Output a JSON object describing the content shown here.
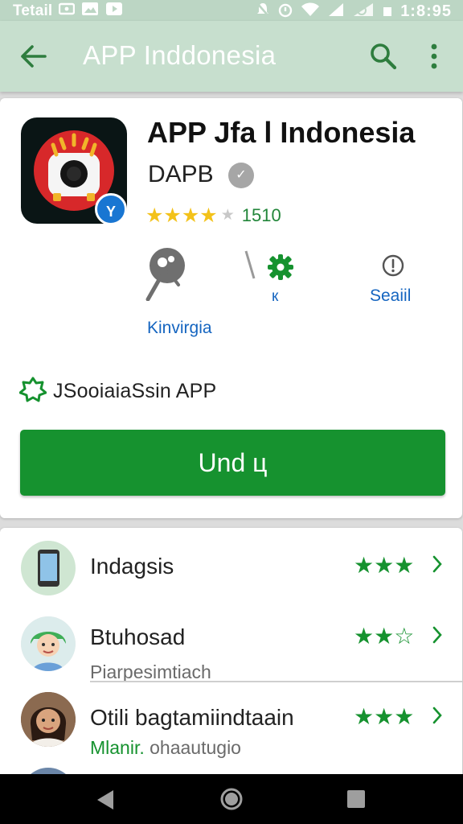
{
  "status_bar": {
    "carrier": "Tetail",
    "time": "1:8:95",
    "icons": [
      "mail-icon",
      "photo-icon",
      "play-icon",
      "mute-icon",
      "alarm-icon",
      "wifi-icon",
      "signal-icon",
      "no-sim-icon",
      "battery-icon"
    ]
  },
  "app_bar": {
    "title": "APP Inddonesia",
    "icons": [
      "back-arrow-icon",
      "search-icon",
      "more-vert-icon"
    ]
  },
  "app": {
    "title": "APP Jfa l Indonesia",
    "developer": "DAPB",
    "badge": "Y",
    "rating_stars": 4,
    "rating_count": "1510"
  },
  "actions": [
    {
      "label": "Kinvirgia",
      "icon": "mascot-icon"
    },
    {
      "label": "к",
      "icon": "gear-icon"
    },
    {
      "label": "Seaiil",
      "icon": "info-icon"
    }
  ],
  "feature_text": "JSooiaiaSsin APP",
  "install_button": "Und ц",
  "list": [
    {
      "title": "Indagsis",
      "subtitle": "",
      "stars": "★★★",
      "avatar": "phone-icon"
    },
    {
      "title": "Btuhosad",
      "subtitle": "Piarpesimtiach",
      "stars": "★★☆",
      "avatar": "avatar-green-hair"
    },
    {
      "title": "Otili bagtamiindtaain",
      "subtitle_highlight": "Mlanir.",
      "subtitle": " ohaautugio",
      "stars": "★★★",
      "avatar": "avatar-woman"
    }
  ],
  "colors": {
    "accent_green": "#16922f",
    "app_bar": "#c7dfce",
    "link_blue": "#1565c0",
    "star_yellow": "#f3c21a"
  },
  "nav_bar": {
    "icons": [
      "back-triangle-icon",
      "home-circle-icon",
      "recents-square-icon"
    ]
  }
}
